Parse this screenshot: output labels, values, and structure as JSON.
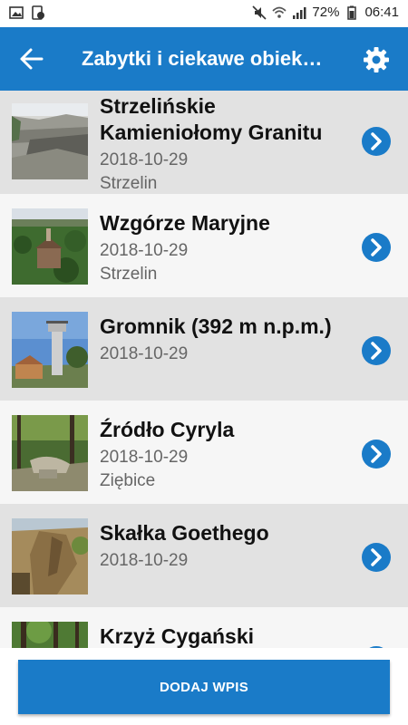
{
  "status_bar": {
    "battery": "72%",
    "time": "06:41"
  },
  "app_bar": {
    "title": "Zabytki i ciekawe obiek…",
    "back_icon": "arrow-left-icon",
    "settings_icon": "gear-icon",
    "color": "#1a7bc8"
  },
  "items": [
    {
      "title": "Strzelińskie Kamieniołomy Granitu",
      "date": "2018-10-29",
      "location": "Strzelin"
    },
    {
      "title": "Wzgórze Maryjne",
      "date": "2018-10-29",
      "location": "Strzelin"
    },
    {
      "title": "Gromnik (392 m n.p.m.)",
      "date": "2018-10-29",
      "location": ""
    },
    {
      "title": "Źródło Cyryla",
      "date": "2018-10-29",
      "location": "Ziębice"
    },
    {
      "title": "Skałka Goethego",
      "date": "2018-10-29",
      "location": ""
    },
    {
      "title": "Krzyż Cygański",
      "date": "",
      "location": ""
    }
  ],
  "add_button": {
    "label": "DODAJ WPIS"
  }
}
